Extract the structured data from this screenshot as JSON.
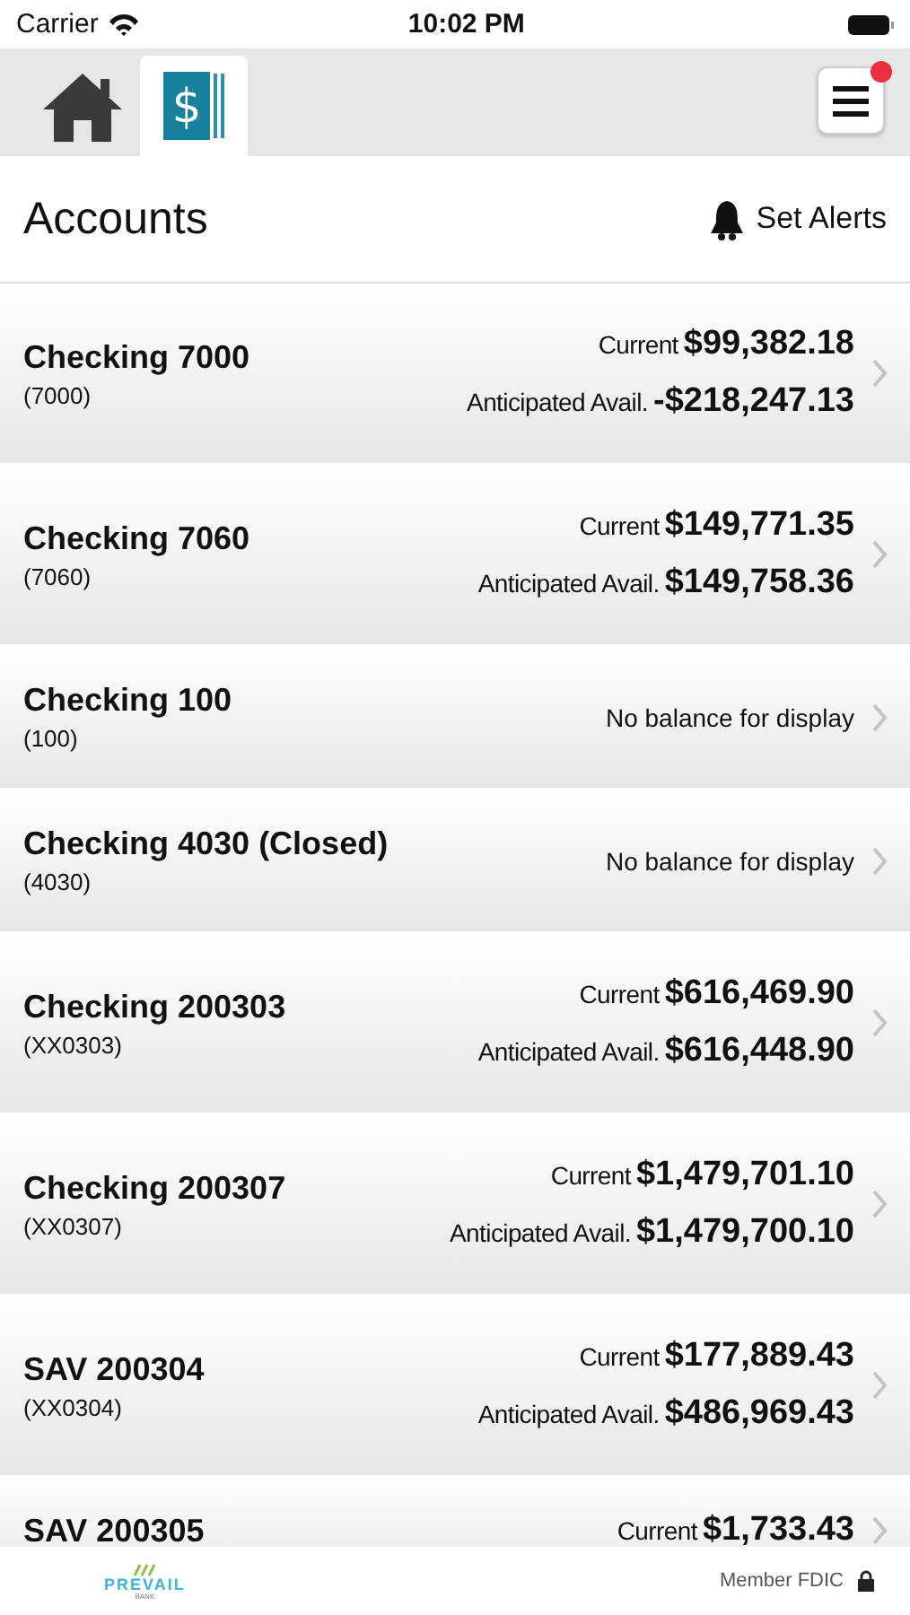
{
  "status_bar": {
    "carrier": "Carrier",
    "time": "10:02 PM"
  },
  "nav": {
    "tabs": [
      {
        "kind": "home",
        "selected": false
      },
      {
        "kind": "accounts",
        "selected": true,
        "symbol": "$"
      }
    ],
    "menu_badge": true
  },
  "header": {
    "title": "Accounts",
    "alerts_label": "Set Alerts"
  },
  "accounts": [
    {
      "name": "Checking 7000",
      "number": "(7000)",
      "kind": "balances",
      "balances": [
        {
          "label": "Current",
          "amount": "$99,382.18"
        },
        {
          "label": "Anticipated Avail.",
          "amount": "-$218,247.13"
        }
      ]
    },
    {
      "name": "Checking 7060",
      "number": "(7060)",
      "kind": "balances",
      "balances": [
        {
          "label": "Current",
          "amount": "$149,771.35"
        },
        {
          "label": "Anticipated Avail.",
          "amount": "$149,758.36"
        }
      ]
    },
    {
      "name": "Checking 100",
      "number": "(100)",
      "kind": "message",
      "message": "No balance for display"
    },
    {
      "name": "Checking 4030 (Closed)",
      "number": "(4030)",
      "kind": "message",
      "message": "No balance for display"
    },
    {
      "name": "Checking 200303",
      "number": "(XX0303)",
      "kind": "balances",
      "balances": [
        {
          "label": "Current",
          "amount": "$616,469.90"
        },
        {
          "label": "Anticipated Avail.",
          "amount": "$616,448.90"
        }
      ]
    },
    {
      "name": "Checking 200307",
      "number": "(XX0307)",
      "kind": "balances",
      "balances": [
        {
          "label": "Current",
          "amount": "$1,479,701.10"
        },
        {
          "label": "Anticipated Avail.",
          "amount": "$1,479,700.10"
        }
      ]
    },
    {
      "name": "SAV 200304",
      "number": "(XX0304)",
      "kind": "balances",
      "balances": [
        {
          "label": "Current",
          "amount": "$177,889.43"
        },
        {
          "label": "Anticipated Avail.",
          "amount": "$486,969.43"
        }
      ]
    },
    {
      "name": "SAV 200305",
      "kind": "balances",
      "balances": [
        {
          "label": "Current",
          "amount": "$1,733.43"
        }
      ]
    }
  ],
  "footer": {
    "logo_text": "PREVAIL",
    "logo_subtext": "BANK",
    "fdic": "Member FDIC"
  }
}
